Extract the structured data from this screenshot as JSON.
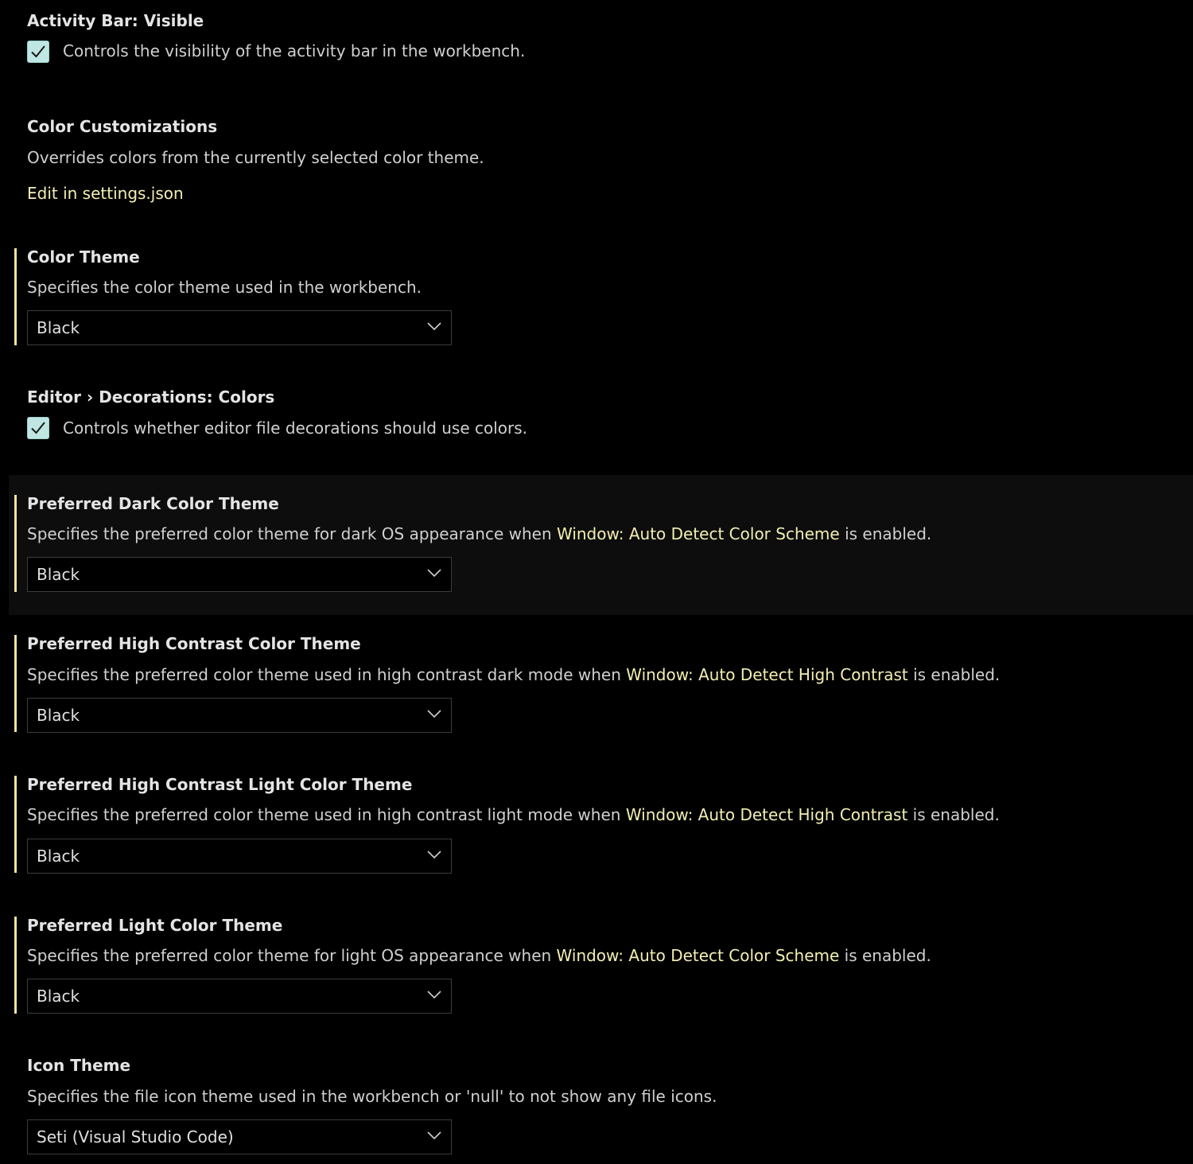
{
  "settings": {
    "activity_bar": {
      "title": "Activity Bar: Visible",
      "description": "Controls the visibility of the activity bar in the workbench.",
      "checked": true
    },
    "color_customizations": {
      "title": "Color Customizations",
      "description": "Overrides colors from the currently selected color theme.",
      "link": "Edit in settings.json"
    },
    "color_theme": {
      "title": "Color Theme",
      "description": "Specifies the color theme used in the workbench.",
      "value": "Black"
    },
    "editor_decorations": {
      "category": "Editor › ",
      "title": "Decorations: Colors",
      "description": "Controls whether editor file decorations should use colors.",
      "checked": true
    },
    "preferred_dark": {
      "title": "Preferred Dark Color Theme",
      "desc_before": "Specifies the preferred color theme for dark OS appearance when ",
      "desc_link": "Window: Auto Detect Color Scheme",
      "desc_after": " is enabled.",
      "value": "Black"
    },
    "preferred_hc": {
      "title": "Preferred High Contrast Color Theme",
      "desc_before": "Specifies the preferred color theme used in high contrast dark mode when ",
      "desc_link": "Window: Auto Detect High Contrast",
      "desc_after": " is enabled.",
      "value": "Black"
    },
    "preferred_hc_light": {
      "title": "Preferred High Contrast Light Color Theme",
      "desc_before": "Specifies the preferred color theme used in high contrast light mode when ",
      "desc_link": "Window: Auto Detect High Contrast",
      "desc_after": " is enabled.",
      "value": "Black"
    },
    "preferred_light": {
      "title": "Preferred Light Color Theme",
      "desc_before": "Specifies the preferred color theme for light OS appearance when ",
      "desc_link": "Window: Auto Detect Color Scheme",
      "desc_after": " is enabled.",
      "value": "Black"
    },
    "icon_theme": {
      "title": "Icon Theme",
      "description": "Specifies the file icon theme used in the workbench or 'null' to not show any file icons.",
      "value": "Seti (Visual Studio Code)"
    }
  },
  "colors": {
    "background": "#000000",
    "modified_indicator": "#f2e3a4",
    "link": "#f3efb3",
    "checkbox": "#bfe6e3"
  }
}
